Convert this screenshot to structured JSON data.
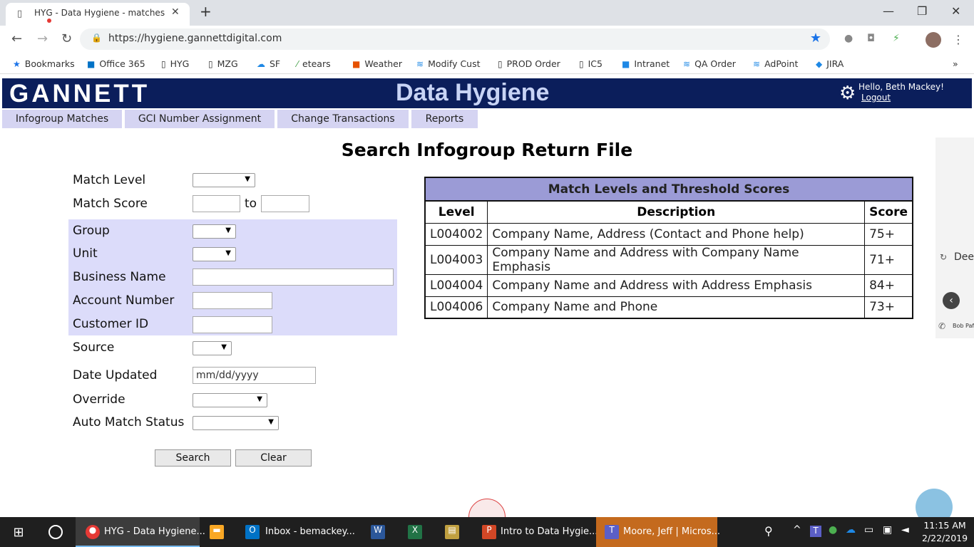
{
  "browser": {
    "tab_title": "HYG - Data Hygiene - matches",
    "url": "https://hygiene.gannettdigital.com",
    "bookmarks": [
      "Bookmarks",
      "Office 365",
      "HYG",
      "MZG",
      "SF",
      "etears",
      "Weather",
      "Modify Cust",
      "PROD Order",
      "IC5",
      "Intranet",
      "QA Order",
      "AdPoint",
      "JIRA"
    ]
  },
  "header": {
    "logo": "GANNETT",
    "title": "Data Hygiene",
    "greeting": "Hello, Beth Mackey!",
    "logout": "Logout"
  },
  "menu": [
    "Infogroup Matches",
    "GCI Number Assignment",
    "Change Transactions",
    "Reports"
  ],
  "page_title": "Search Infogroup Return File",
  "form": {
    "match_level": "Match Level",
    "match_score": "Match Score",
    "to": "to",
    "group": "Group",
    "unit": "Unit",
    "business_name": "Business Name",
    "account_number": "Account Number",
    "customer_id": "Customer ID",
    "source": "Source",
    "date_updated": "Date Updated",
    "date_placeholder": "mm/dd/yyyy",
    "override": "Override",
    "auto_match_status": "Auto Match Status",
    "search_btn": "Search",
    "clear_btn": "Clear"
  },
  "threshold_table": {
    "caption": "Match Levels and Threshold Scores",
    "headers": [
      "Level",
      "Description",
      "Score"
    ],
    "rows": [
      [
        "L004002",
        "Company Name, Address (Contact and Phone help)",
        "75+"
      ],
      [
        "L004003",
        "Company Name and Address with Company Name Emphasis",
        "71+"
      ],
      [
        "L004004",
        "Company Name and Address with Address Emphasis",
        "84+"
      ],
      [
        "L004006",
        "Company Name and Phone",
        "73+"
      ]
    ]
  },
  "side_panel": {
    "deep": "Deep",
    "bob": "Bob Paf"
  },
  "taskbar": {
    "chrome": "HYG - Data Hygiene...",
    "outlook": "Inbox - bemackey...",
    "ppt": "Intro to Data Hygie...",
    "teams": "Moore, Jeff | Micros...",
    "time": "11:15 AM",
    "date": "2/22/2019"
  }
}
